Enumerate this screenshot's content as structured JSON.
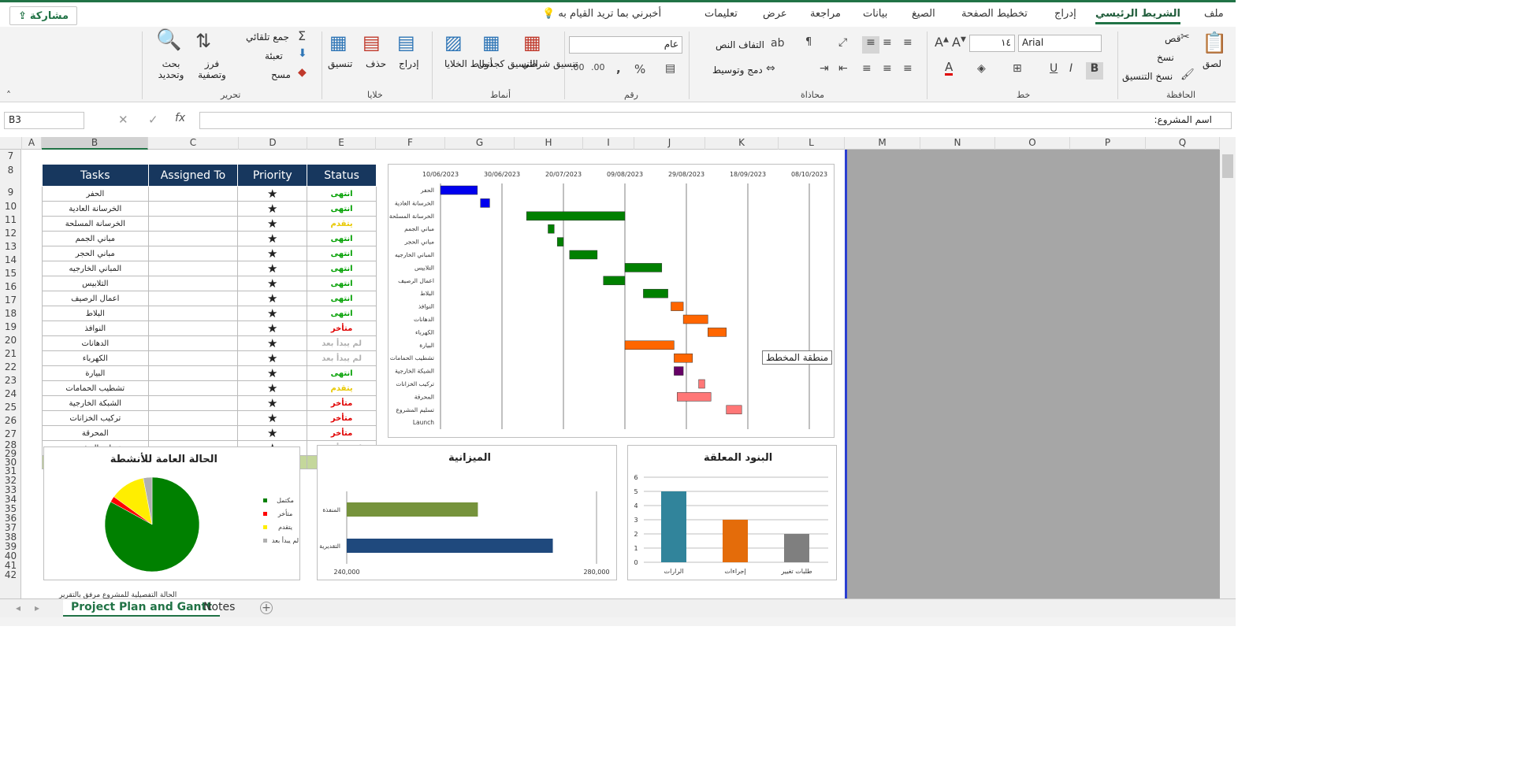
{
  "tabs": [
    "ملف",
    "الشريط الرئيسي",
    "إدراج",
    "تخطيط الصفحة",
    "الصيغ",
    "بيانات",
    "مراجعة",
    "عرض",
    "تعليمات"
  ],
  "tell_me": "أخبرني بما تريد القيام به",
  "share": "مشاركة",
  "ribbon": {
    "clipboard": {
      "label": "الحافظة",
      "paste": "لصق",
      "cut": "قص",
      "copy": "نسخ",
      "format_painter": "نسخ التنسيق"
    },
    "font": {
      "label": "خط",
      "name": "Arial",
      "size": "١٤"
    },
    "alignment": {
      "label": "محاذاة",
      "wrap": "التفاف النص",
      "merge": "دمج وتوسيط"
    },
    "number": {
      "label": "رقم",
      "format": "عام"
    },
    "styles": {
      "label": "أنماط",
      "conditional": "تنسيق شرطي",
      "as_table": "التنسيق كجدول",
      "cell_styles": "أنماط الخلايا"
    },
    "cells": {
      "label": "خلايا",
      "insert": "إدراج",
      "delete": "حذف",
      "format": "تنسيق"
    },
    "editing": {
      "label": "تحرير",
      "autosum": "جمع تلقائي",
      "fill": "تعبئة",
      "clear": "مسح",
      "sort": "فرز وتصفية",
      "find": "بحث وتحديد"
    }
  },
  "namebox": "B3",
  "formula": "اسم المشروع:",
  "columns": [
    "A",
    "B",
    "C",
    "D",
    "E",
    "F",
    "G",
    "H",
    "I",
    "J",
    "K",
    "L",
    "M",
    "N",
    "O",
    "P",
    "Q"
  ],
  "rows": [
    "7",
    "8",
    "9",
    "10",
    "11",
    "12",
    "13",
    "14",
    "15",
    "16",
    "17",
    "18",
    "19",
    "20",
    "21",
    "22",
    "23",
    "24",
    "25",
    "26",
    "27",
    "28",
    "29",
    "30",
    "31",
    "32",
    "33",
    "34",
    "35",
    "36",
    "37",
    "38",
    "39",
    "40",
    "41",
    "42"
  ],
  "table": {
    "headers": [
      "Tasks",
      "Assigned To",
      "Priority",
      "Status"
    ],
    "rows": [
      {
        "task": "الحفر",
        "priority": "★",
        "status": "انتهى",
        "color": "#00a000"
      },
      {
        "task": "الخرسانة العادية",
        "priority": "★",
        "status": "انتهى",
        "color": "#00a000"
      },
      {
        "task": "الخرسانة المسلحة",
        "priority": "★",
        "status": "يتقدم",
        "color": "#e8c800"
      },
      {
        "task": "مباني الجمم",
        "priority": "★",
        "status": "انتهى",
        "color": "#00a000"
      },
      {
        "task": "مباني الحجر",
        "priority": "★",
        "status": "انتهى",
        "color": "#00a000"
      },
      {
        "task": "المباني الخارجيه",
        "priority": "★",
        "status": "انتهى",
        "color": "#00a000"
      },
      {
        "task": "التلابيس",
        "priority": "★",
        "status": "انتهى",
        "color": "#00a000"
      },
      {
        "task": "اعمال الرصيف",
        "priority": "★",
        "status": "انتهى",
        "color": "#00a000"
      },
      {
        "task": "البلاط",
        "priority": "★",
        "status": "انتهى",
        "color": "#00a000"
      },
      {
        "task": "النوافذ",
        "priority": "★",
        "status": "متأخر",
        "color": "#e00000"
      },
      {
        "task": "الدهانات",
        "priority": "★",
        "status": "لم يبدأ بعد",
        "color": "#b0b0b0"
      },
      {
        "task": "الكهرباء",
        "priority": "★",
        "status": "لم يبدأ بعد",
        "color": "#b0b0b0"
      },
      {
        "task": "البيارة",
        "priority": "★",
        "status": "انتهى",
        "color": "#00a000"
      },
      {
        "task": "تشطيب الحمامات",
        "priority": "★",
        "status": "يتقدم",
        "color": "#e8c800"
      },
      {
        "task": "الشبكة الخارجية",
        "priority": "★",
        "status": "متأخر",
        "color": "#e00000"
      },
      {
        "task": "تركيب الخزانات",
        "priority": "★",
        "status": "متأخر",
        "color": "#e00000"
      },
      {
        "task": "المحرقة",
        "priority": "★",
        "status": "متأخر",
        "color": "#e00000"
      },
      {
        "task": "تسليم المشروع",
        "priority": "★",
        "status": "لم يبدأ بعد",
        "color": "#b0b0b0"
      }
    ],
    "launch": "Launch"
  },
  "tooltip": "منطقة المخطط",
  "footnote": "الحالة التفصيلية للمشروع مرفق بالتقرير",
  "sheets": [
    "Project Plan and Gantt",
    "Notes"
  ],
  "chart_data": [
    {
      "type": "bar",
      "orientation": "horizontal-gantt",
      "title": "",
      "x_ticks": [
        "10/06/2023",
        "30/06/2023",
        "20/07/2023",
        "09/08/2023",
        "29/08/2023",
        "18/09/2023",
        "08/10/2023"
      ],
      "categories": [
        "الحفر",
        "الخرسانة العادية",
        "الخرسانة المسلحة",
        "مباني الجمم",
        "مباني الحجر",
        "المباني الخارجيه",
        "التلابيس",
        "اعمال الرصيف",
        "البلاط",
        "النوافذ",
        "الدهانات",
        "الكهرباء",
        "البيارة",
        "تشطيب الحمامات",
        "الشبكة الخارجية",
        "تركيب الخزانات",
        "المحرقة",
        "تسليم المشروع",
        "Launch"
      ],
      "bars": [
        {
          "start": "2023-06-10",
          "end": "2023-06-22",
          "color": "#0000ee"
        },
        {
          "start": "2023-06-23",
          "end": "2023-06-26",
          "color": "#0000ee"
        },
        {
          "start": "2023-07-08",
          "end": "2023-08-09",
          "color": "#008000"
        },
        {
          "start": "2023-07-15",
          "end": "2023-07-17",
          "color": "#008000"
        },
        {
          "start": "2023-07-18",
          "end": "2023-07-20",
          "color": "#008000"
        },
        {
          "start": "2023-07-22",
          "end": "2023-07-31",
          "color": "#008000"
        },
        {
          "start": "2023-08-09",
          "end": "2023-08-21",
          "color": "#008000"
        },
        {
          "start": "2023-08-02",
          "end": "2023-08-09",
          "color": "#008000"
        },
        {
          "start": "2023-08-15",
          "end": "2023-08-23",
          "color": "#008000"
        },
        {
          "start": "2023-08-24",
          "end": "2023-08-28",
          "color": "#ff6600"
        },
        {
          "start": "2023-08-28",
          "end": "2023-09-05",
          "color": "#ff6600"
        },
        {
          "start": "2023-09-05",
          "end": "2023-09-11",
          "color": "#ff6600"
        },
        {
          "start": "2023-08-09",
          "end": "2023-08-25",
          "color": "#ff6600"
        },
        {
          "start": "2023-08-25",
          "end": "2023-08-31",
          "color": "#ff6600"
        },
        {
          "start": "2023-08-25",
          "end": "2023-08-28",
          "color": "#660066"
        },
        {
          "start": "2023-09-02",
          "end": "2023-09-04",
          "color": "#ff7777"
        },
        {
          "start": "2023-08-26",
          "end": "2023-09-06",
          "color": "#ff7777"
        },
        {
          "start": "2023-09-11",
          "end": "2023-09-16",
          "color": "#ff7777"
        }
      ],
      "xlim": [
        "2023-06-10",
        "2023-10-08"
      ]
    },
    {
      "type": "pie",
      "title": "الحالة العامة للأنشطة",
      "labels": [
        "مكتمل",
        "متأخر",
        "يتقدم",
        "لم يبدأ بعد"
      ],
      "values": [
        83,
        2,
        12,
        3
      ],
      "colors": [
        "#008000",
        "#ff0000",
        "#ffee00",
        "#b0b0b0"
      ],
      "legend": "right"
    },
    {
      "type": "bar",
      "orientation": "horizontal",
      "title": "الميزانية",
      "categories": [
        "المنفذة",
        "التقديرية"
      ],
      "values": [
        261000,
        273000
      ],
      "colors": [
        "#76933c",
        "#1f497d"
      ],
      "x_ticks": [
        "240,000",
        "280,000"
      ],
      "xlim": [
        240000,
        280000
      ]
    },
    {
      "type": "bar",
      "title": "البنود المعلقة",
      "categories": [
        "الرارات",
        "إجراءات",
        "طلبات تغيير"
      ],
      "values": [
        5,
        3,
        2
      ],
      "colors": [
        "#31849b",
        "#e46c0a",
        "#7f7f7f"
      ],
      "ylim": [
        0,
        6
      ],
      "y_ticks": [
        "0",
        "1",
        "2",
        "3",
        "4",
        "5",
        "6"
      ]
    }
  ]
}
